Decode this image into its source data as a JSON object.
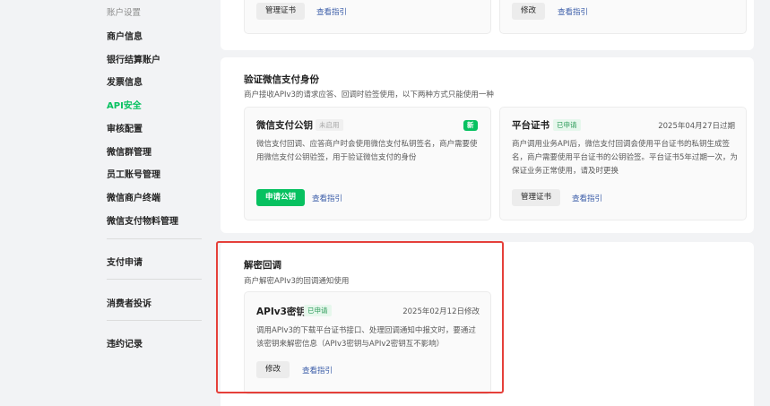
{
  "sidebar": {
    "header": "账户设置",
    "items": [
      {
        "label": "商户信息"
      },
      {
        "label": "银行结算账户"
      },
      {
        "label": "发票信息"
      },
      {
        "label": "API安全"
      },
      {
        "label": "审核配置"
      },
      {
        "label": "微信群管理"
      },
      {
        "label": "员工账号管理"
      },
      {
        "label": "微信商户终端"
      },
      {
        "label": "微信支付物料管理"
      }
    ],
    "items2": [
      {
        "label": "支付申请"
      },
      {
        "label": "消费者投诉"
      },
      {
        "label": "违约记录"
      }
    ],
    "active": "API安全"
  },
  "top_cards": {
    "left": {
      "button": "管理证书",
      "link": "查看指引"
    },
    "right": {
      "button": "修改",
      "link": "查看指引"
    }
  },
  "verify": {
    "title": "验证微信支付身份",
    "desc": "商户接收APIv3的请求应答、回调时验签使用，以下两种方式只能使用一种",
    "public_key": {
      "title": "微信支付公钥",
      "status": "未启用",
      "new_badge": "新",
      "desc": "微信支付回调、应答商户时会使用微信支付私钥签名，商户需要使用微信支付公钥验签，用于验证微信支付的身份",
      "button": "申请公钥",
      "link": "查看指引"
    },
    "platform_cert": {
      "title": "平台证书",
      "status": "已申请",
      "expiry": "2025年04月27日过期",
      "desc": "商户调用业务API后，微信支付回调会使用平台证书的私钥生成签名，商户需要使用平台证书的公钥验签。平台证书5年过期一次，为保证业务正常使用，请及时更换",
      "button": "管理证书",
      "link": "查看指引"
    }
  },
  "decrypt": {
    "title": "解密回调",
    "desc": "商户解密APIv3的回调通知使用",
    "key_card": {
      "title": "APIv3密钥",
      "status": "已申请",
      "modified": "2025年02月12日修改",
      "desc": "调用APIv3的下载平台证书接口、处理回调通知中报文时，要通过该密钥来解密信息（APIv3密钥与APIv2密钥互不影响）",
      "button": "修改",
      "link": "查看指引"
    }
  },
  "colors": {
    "accent": "#07c160",
    "link": "#3a5ca8",
    "highlight": "#e5403a"
  }
}
